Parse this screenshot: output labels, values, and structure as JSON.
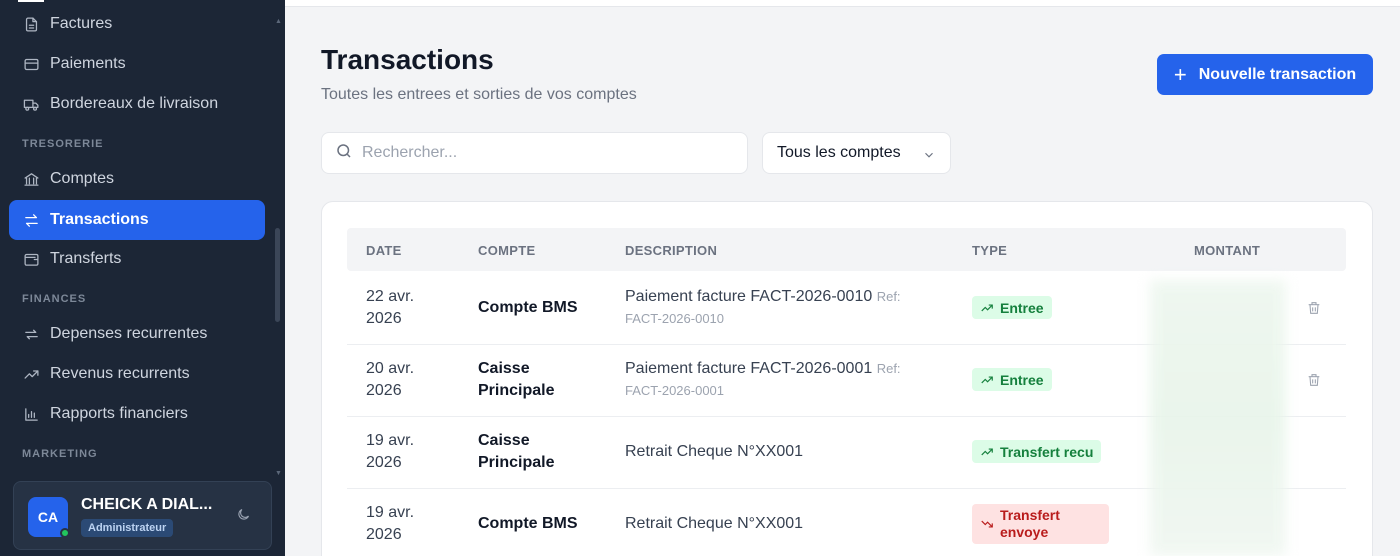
{
  "sidebar": {
    "items": [
      {
        "label": "Factures",
        "icon": "file-text-icon"
      },
      {
        "label": "Paiements",
        "icon": "credit-card-icon"
      },
      {
        "label": "Bordereaux de livraison",
        "icon": "truck-icon"
      },
      {
        "label": "Comptes",
        "icon": "bank-icon"
      },
      {
        "label": "Transactions",
        "icon": "arrows-swap-icon",
        "active": true
      },
      {
        "label": "Transferts",
        "icon": "wallet-icon"
      },
      {
        "label": "Depenses recurrentes",
        "icon": "repeat-icon"
      },
      {
        "label": "Revenus recurrents",
        "icon": "trending-up-icon"
      },
      {
        "label": "Rapports financiers",
        "icon": "bar-chart-icon"
      }
    ],
    "sections": {
      "tresorerie": "TRESORERIE",
      "finances": "FINANCES",
      "marketing": "MARKETING"
    },
    "user": {
      "initials": "CA",
      "name": "CHEICK A DIAL...",
      "role": "Administrateur"
    }
  },
  "header": {
    "title": "Transactions",
    "subtitle": "Toutes les entrees et sorties de vos comptes",
    "new_button": "Nouvelle transaction"
  },
  "filters": {
    "search_placeholder": "Rechercher...",
    "account_select": "Tous les comptes"
  },
  "table": {
    "columns": [
      "DATE",
      "COMPTE",
      "DESCRIPTION",
      "TYPE",
      "MONTANT"
    ],
    "rows": [
      {
        "date1": "22 avr.",
        "date2": "2026",
        "account1": "Compte BMS",
        "account2": "",
        "description": "Paiement facture FACT-2026-0010",
        "ref_label": "Ref:",
        "ref": "FACT-2026-0010",
        "type": "Entree",
        "type_kind": "in"
      },
      {
        "date1": "20 avr.",
        "date2": "2026",
        "account1": "Caisse",
        "account2": "Principale",
        "description": "Paiement facture FACT-2026-0001",
        "ref_label": "Ref:",
        "ref": "FACT-2026-0001",
        "type": "Entree",
        "type_kind": "in"
      },
      {
        "date1": "19 avr.",
        "date2": "2026",
        "account1": "Caisse",
        "account2": "Principale",
        "description": "Retrait Cheque N°XX001",
        "ref_label": "",
        "ref": "",
        "type": "Transfert recu",
        "type_kind": "in"
      },
      {
        "date1": "19 avr.",
        "date2": "2026",
        "account1": "Compte BMS",
        "account2": "",
        "description": "Retrait Cheque N°XX001",
        "ref_label": "",
        "ref": "",
        "type1": "Transfert",
        "type2": "envoye",
        "type_kind": "out"
      }
    ]
  },
  "colors": {
    "sidebar_bg": "#1c2636",
    "accent": "#2563eb",
    "badge_in_bg": "#dcfce7",
    "badge_in_text": "#15803d",
    "badge_out_bg": "#fee2e2",
    "badge_out_text": "#b91c1c"
  }
}
